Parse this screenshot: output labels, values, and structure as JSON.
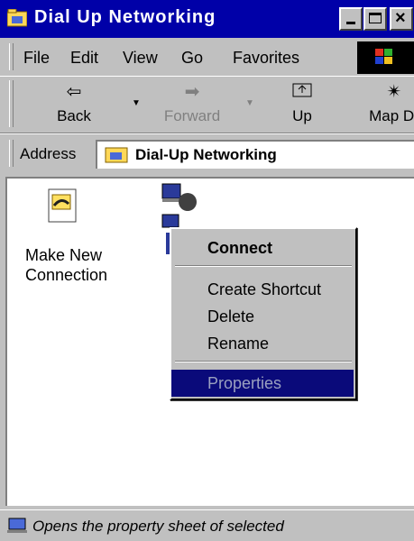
{
  "window": {
    "title": "Dial Up Networking"
  },
  "menu": [
    {
      "label": "File",
      "mnemonic": "F"
    },
    {
      "label": "Edit",
      "mnemonic": "E"
    },
    {
      "label": "View",
      "mnemonic": "V"
    },
    {
      "label": "Go",
      "mnemonic": "G"
    },
    {
      "label": "Favorites",
      "mnemonic": "a"
    }
  ],
  "toolbar": {
    "back": "Back",
    "forward": "Forward",
    "up": "Up",
    "map": "Map Dr"
  },
  "address": {
    "label": "Address",
    "value": "Dial-Up Networking"
  },
  "items": {
    "make_new_line1": "Make New",
    "make_new_line2": "Connection"
  },
  "context_menu": {
    "connect": "Connect",
    "create_shortcut": "Create Shortcut",
    "delete": "Delete",
    "rename": "Rename",
    "properties": "Properties"
  },
  "status": {
    "text": "Opens the property sheet of selected"
  },
  "icons": {
    "title": "dialup-folder-icon",
    "back": "back-arrow-icon",
    "forward": "forward-arrow-icon",
    "up": "up-folder-icon",
    "map": "map-drive-icon",
    "address": "dialup-folder-icon",
    "make_new": "make-new-connection-icon",
    "connection": "connection-icon",
    "status": "status-computer-icon"
  },
  "colors": {
    "titlebar": "#0000a8",
    "selection": "#0a0a7a",
    "chrome": "#c0c0c0"
  }
}
